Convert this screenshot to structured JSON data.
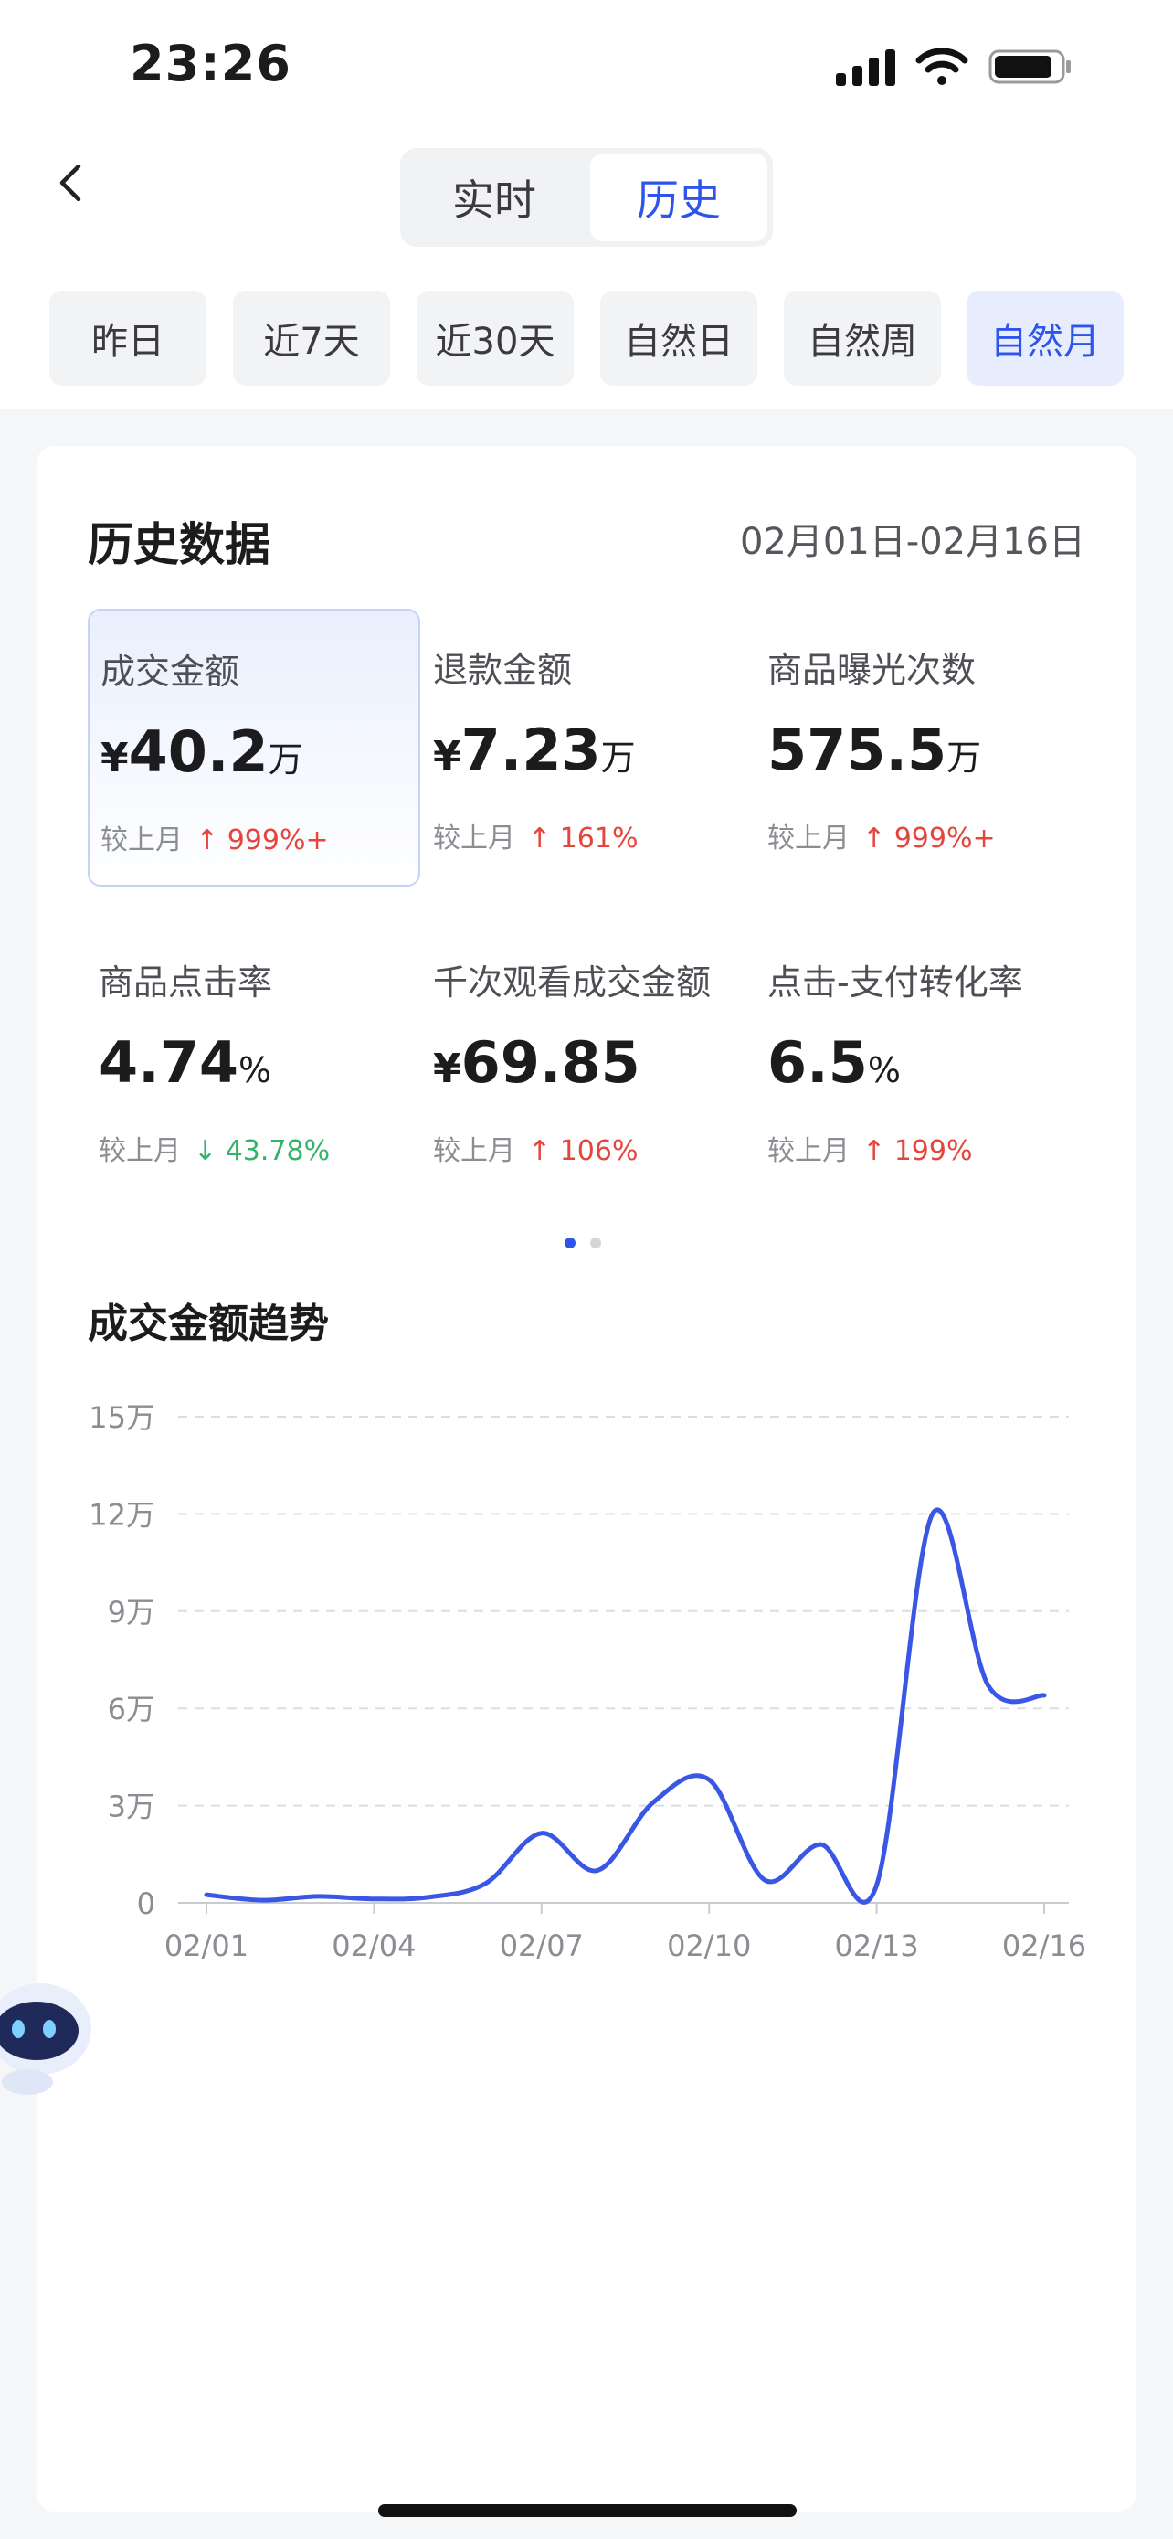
{
  "status_bar": {
    "time": "23:26"
  },
  "tabs": [
    {
      "label": "实时",
      "active": false
    },
    {
      "label": "历史",
      "active": true
    }
  ],
  "filters": [
    {
      "label": "昨日",
      "active": false
    },
    {
      "label": "近7天",
      "active": false
    },
    {
      "label": "近30天",
      "active": false
    },
    {
      "label": "自然日",
      "active": false
    },
    {
      "label": "自然周",
      "active": false
    },
    {
      "label": "自然月",
      "active": true
    }
  ],
  "card": {
    "title": "历史数据",
    "date_range": "02月01日-02月16日"
  },
  "metrics": [
    {
      "label": "成交金额",
      "currency": "¥",
      "value": "40.2",
      "unit": "万",
      "compare_label": "较上月",
      "arrow": "↑",
      "change": "999",
      "change_suffix": "%+",
      "direction": "up",
      "active": true
    },
    {
      "label": "退款金额",
      "currency": "¥",
      "value": "7.23",
      "unit": "万",
      "compare_label": "较上月",
      "arrow": "↑",
      "change": "161",
      "change_suffix": "%",
      "direction": "up",
      "active": false
    },
    {
      "label": "商品曝光次数",
      "currency": "",
      "value": "575.5",
      "unit": "万",
      "compare_label": "较上月",
      "arrow": "↑",
      "change": "999",
      "change_suffix": "%+",
      "direction": "up",
      "active": false
    },
    {
      "label": "商品点击率",
      "currency": "",
      "value": "4.74",
      "unit": "%",
      "compare_label": "较上月",
      "arrow": "↓",
      "change": "43.78",
      "change_suffix": "%",
      "direction": "down",
      "active": false
    },
    {
      "label": "千次观看成交金额",
      "currency": "¥",
      "value": "69.85",
      "unit": "",
      "compare_label": "较上月",
      "arrow": "↑",
      "change": "106",
      "change_suffix": "%",
      "direction": "up",
      "active": false
    },
    {
      "label": "点击-支付转化率",
      "currency": "",
      "value": "6.5",
      "unit": "%",
      "compare_label": "较上月",
      "arrow": "↑",
      "change": "199",
      "change_suffix": "%",
      "direction": "up",
      "active": false
    }
  ],
  "pager": {
    "pages": 2,
    "current": 0
  },
  "trend": {
    "title": "成交金额趋势"
  },
  "colors": {
    "accent": "#2f54eb",
    "up": "#e5453b",
    "down": "#34b36b",
    "line": "#3a56e4"
  },
  "chart_data": {
    "type": "line",
    "title": "成交金额趋势",
    "x": [
      "02/01",
      "02/02",
      "02/03",
      "02/04",
      "02/05",
      "02/06",
      "02/07",
      "02/08",
      "02/09",
      "02/10",
      "02/11",
      "02/12",
      "02/13",
      "02/14",
      "02/15",
      "02/16"
    ],
    "x_tick_labels": [
      "02/01",
      "02/04",
      "02/07",
      "02/10",
      "02/13",
      "02/16"
    ],
    "y_tick_labels": [
      "0",
      "3万",
      "6万",
      "9万",
      "12万",
      "15万"
    ],
    "ylim": [
      0,
      150000
    ],
    "grid": true,
    "series": [
      {
        "values": [
          2500,
          800,
          2000,
          1200,
          1800,
          6000,
          21500,
          10000,
          31000,
          38000,
          7000,
          18000,
          5500,
          120000,
          67000,
          64000
        ]
      }
    ]
  }
}
